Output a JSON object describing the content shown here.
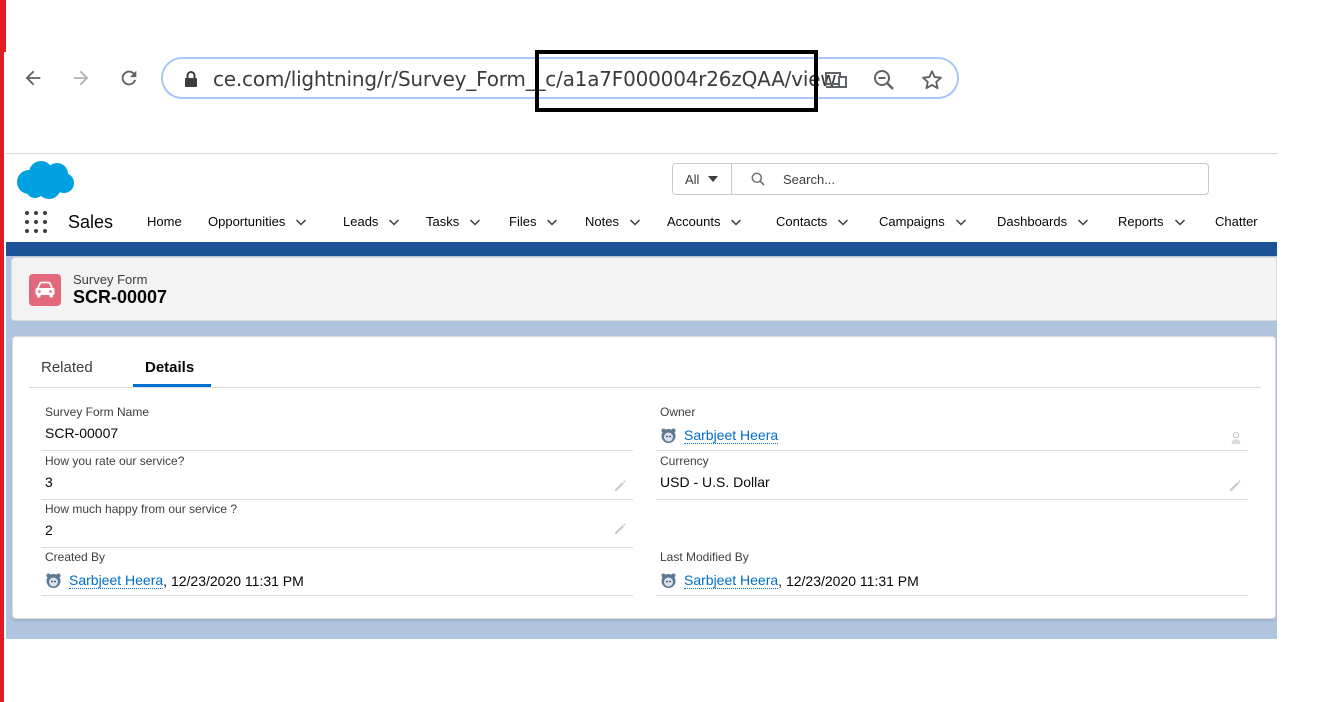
{
  "browser": {
    "url": "ce.com/lightning/r/Survey_Form__c/a1a7F000004r26zQAA/view"
  },
  "header": {
    "search_scope": "All",
    "search_placeholder": "Search...",
    "app_name": "Sales",
    "nav_items": [
      {
        "label": "Home",
        "has_menu": false
      },
      {
        "label": "Opportunities",
        "has_menu": true
      },
      {
        "label": "Leads",
        "has_menu": true
      },
      {
        "label": "Tasks",
        "has_menu": true
      },
      {
        "label": "Files",
        "has_menu": true
      },
      {
        "label": "Notes",
        "has_menu": true
      },
      {
        "label": "Accounts",
        "has_menu": true
      },
      {
        "label": "Contacts",
        "has_menu": true
      },
      {
        "label": "Campaigns",
        "has_menu": true
      },
      {
        "label": "Dashboards",
        "has_menu": true
      },
      {
        "label": "Reports",
        "has_menu": true
      },
      {
        "label": "Chatter",
        "has_menu": false
      }
    ]
  },
  "record": {
    "object_label": "Survey Form",
    "name": "SCR-00007",
    "icon": "car-icon",
    "icon_color": "#e3687b"
  },
  "tabs": [
    {
      "label": "Related",
      "active": false
    },
    {
      "label": "Details",
      "active": true
    }
  ],
  "fields": {
    "survey_form_name": {
      "label": "Survey Form Name",
      "value": "SCR-00007"
    },
    "owner": {
      "label": "Owner",
      "value": "Sarbjeet Heera"
    },
    "rate_service": {
      "label": "How you rate our service?",
      "value": "3"
    },
    "currency": {
      "label": "Currency",
      "value": "USD - U.S. Dollar"
    },
    "happy_service": {
      "label": "How much happy from our service ?",
      "value": "2"
    },
    "created_by": {
      "label": "Created By",
      "user": "Sarbjeet Heera",
      "date": ", 12/23/2020 11:31 PM"
    },
    "last_modified_by": {
      "label": "Last Modified By",
      "user": "Sarbjeet Heera",
      "date": ", 12/23/2020 11:31 PM"
    }
  },
  "colors": {
    "brand_blue": "#1b5297",
    "link": "#006dcc",
    "accent_tab": "#0070d2",
    "salesforce_cloud": "#00a1e0"
  }
}
